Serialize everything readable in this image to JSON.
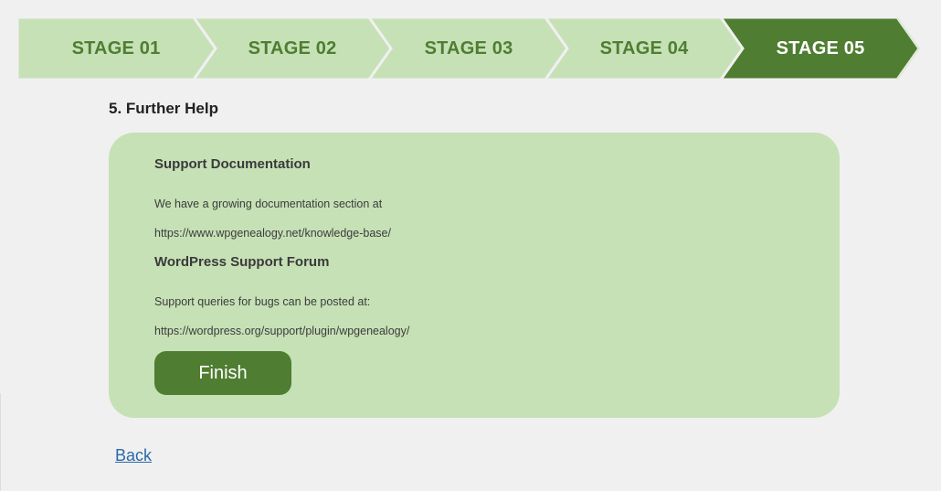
{
  "colors": {
    "page_background": "#f0f0f0",
    "stage_inactive_fill": "#c6e1b6",
    "stage_inactive_text": "#4f7d31",
    "stage_active_fill": "#4f7d31",
    "stage_active_text": "#ffffff",
    "panel_background": "#c6e1b6",
    "button_background": "#4f7d31",
    "link_color": "#2b6aa8"
  },
  "stepper": {
    "current_stage": 5,
    "stages": [
      {
        "label": "STAGE 01",
        "active": false
      },
      {
        "label": "STAGE 02",
        "active": false
      },
      {
        "label": "STAGE 03",
        "active": false
      },
      {
        "label": "STAGE 04",
        "active": false
      },
      {
        "label": "STAGE 05",
        "active": true
      }
    ]
  },
  "section": {
    "heading": "5. Further Help"
  },
  "panel": {
    "support_docs": {
      "title": "Support Documentation",
      "text": "We have a growing documentation section at",
      "url": "https://www.wpgenealogy.net/knowledge-base/"
    },
    "support_forum": {
      "title": "WordPress Support Forum",
      "text": "Support queries for bugs can be posted at:",
      "url": "https://wordpress.org/support/plugin/wpgenealogy/"
    },
    "finish_label": "Finish"
  },
  "back_label": "Back"
}
